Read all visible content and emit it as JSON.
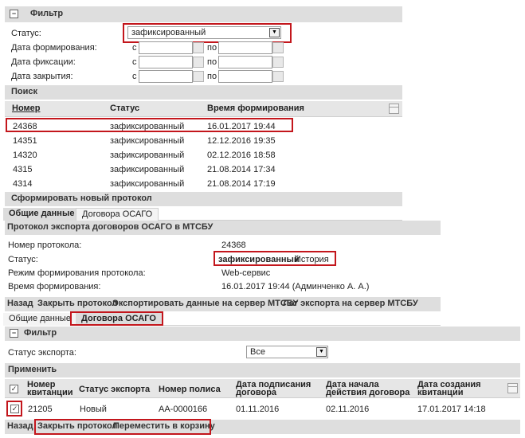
{
  "filter1": {
    "title": "Фильтр",
    "status_label": "Статус:",
    "status_value": "зафиксированный",
    "formed_label": "Дата формирования:",
    "fixed_label": "Дата фиксации:",
    "closed_label": "Дата закрытия:",
    "from_label": "с",
    "to_label": "по"
  },
  "search": {
    "title": "Поиск",
    "col_number": "Номер",
    "col_status": "Статус",
    "col_time": "Время формирования",
    "rows": [
      {
        "number": "24368",
        "status": "зафиксированный",
        "time": "16.01.2017 19:44"
      },
      {
        "number": "14351",
        "status": "зафиксированный",
        "time": "12.12.2016 19:35"
      },
      {
        "number": "14320",
        "status": "зафиксированный",
        "time": "02.12.2016 18:58"
      },
      {
        "number": "4315",
        "status": "зафиксированный",
        "time": "21.08.2014 17:34"
      },
      {
        "number": "4314",
        "status": "зафиксированный",
        "time": "21.08.2014 17:19"
      }
    ],
    "new_protocol": "Сформировать новый протокол"
  },
  "tabs1": {
    "general": "Общие данные",
    "contracts": "Договора ОСАГО"
  },
  "protocol": {
    "title": "Протокол экспорта договоров ОСАГО в МТСБУ",
    "number_label": "Номер протокола:",
    "number_value": "24368",
    "status_label": "Статус:",
    "status_value": "зафиксированный",
    "history_link": "История",
    "mode_label": "Режим формирования протокола:",
    "mode_value": "Web-сервис",
    "time_label": "Время формирования:",
    "time_value": "16.01.2017 19:44 (Админченко А. А.)"
  },
  "actions1": {
    "back": "Назад",
    "close": "Закрыть протокол",
    "export": "Экспортировать данные на сервер МТСБУ",
    "log": "Лог экспорта на сервер МТСБУ"
  },
  "tabs2": {
    "general": "Общие данные",
    "contracts": "Договора ОСАГО"
  },
  "filter2": {
    "title": "Фильтр",
    "export_status_label": "Статус экспорта:",
    "export_status_value": "Все",
    "apply": "Применить"
  },
  "contracts": {
    "col_receipt": "Номер квитанции",
    "col_export_status": "Статус экспорта",
    "col_policy": "Номер полиса",
    "col_signed": "Дата подписания договора",
    "col_start": "Дата начала действия договора",
    "col_created": "Дата создания квитанции",
    "rows": [
      {
        "receipt": "21205",
        "export_status": "Новый",
        "policy": "АА-0000166",
        "signed": "01.11.2016",
        "start": "02.11.2016",
        "created": "17.01.2017 14:18",
        "checked": "✓"
      }
    ],
    "header_checked": "✓"
  },
  "actions2": {
    "back": "Назад",
    "close": "Закрыть протокол",
    "trash": "Переместить в корзину"
  }
}
